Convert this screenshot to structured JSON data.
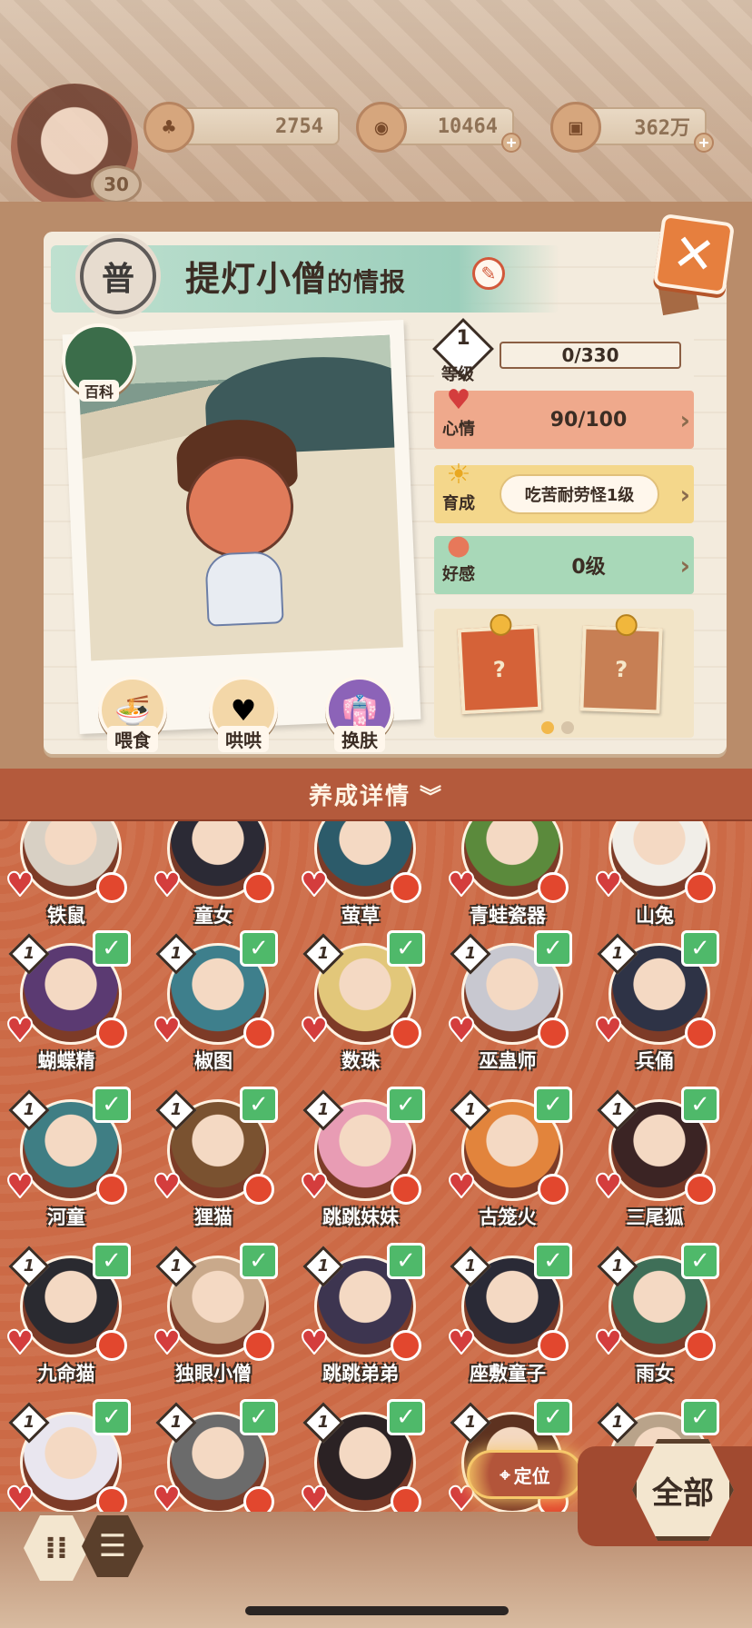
{
  "hud": {
    "player_level": "30",
    "resources": [
      {
        "name": "jade",
        "icon": "pine-coin-icon",
        "value": "2754"
      },
      {
        "name": "stamina",
        "icon": "spiral-coin-icon",
        "value": "10464"
      },
      {
        "name": "gold",
        "icon": "copper-coin-icon",
        "value": "362万"
      }
    ]
  },
  "info": {
    "rank": "普",
    "name": "提灯小僧",
    "name_suffix": "的情报",
    "wiki_label": "百科",
    "actions": [
      {
        "label": "喂食",
        "icon": "bowl-icon"
      },
      {
        "label": "哄哄",
        "icon": "milk-icon"
      },
      {
        "label": "换肤",
        "icon": "clothes-icon"
      }
    ],
    "level": {
      "value": "1",
      "label": "等级",
      "progress": "0/330"
    },
    "mood": {
      "label": "心情",
      "value": "90/100"
    },
    "growth": {
      "label": "育成",
      "value": "吃苦耐劳怪1级"
    },
    "affection": {
      "label": "好感",
      "value": "0级"
    },
    "reward_cards": [
      "?",
      "?"
    ],
    "page_dots": 2,
    "active_dot": 0
  },
  "detail_bar": {
    "label": "养成详情",
    "chevron": "»"
  },
  "grid": {
    "level_text": "1",
    "rows": [
      [
        {
          "name": "铁鼠",
          "hair": "#d8d0c4",
          "level": false
        },
        {
          "name": "童女",
          "hair": "#2b2a35",
          "level": false
        },
        {
          "name": "萤草",
          "hair": "#2c5b6a",
          "level": false
        },
        {
          "name": "青蛙瓷器",
          "hair": "#5b8a3c",
          "level": false
        },
        {
          "name": "山兔",
          "hair": "#f1eee8",
          "level": false
        }
      ],
      [
        {
          "name": "蝴蝶精",
          "hair": "#5b3a72",
          "level": true
        },
        {
          "name": "椒图",
          "hair": "#3e7f8c",
          "level": true
        },
        {
          "name": "数珠",
          "hair": "#e2c77a",
          "level": true
        },
        {
          "name": "巫蛊师",
          "hair": "#c8c8d0",
          "level": true
        },
        {
          "name": "兵俑",
          "hair": "#2e3346",
          "level": true
        }
      ],
      [
        {
          "name": "河童",
          "hair": "#3f7e84",
          "level": true
        },
        {
          "name": "狸猫",
          "hair": "#7a5230",
          "level": true
        },
        {
          "name": "跳跳妹妹",
          "hair": "#e89cb4",
          "level": true
        },
        {
          "name": "古笼火",
          "hair": "#e2843c",
          "level": true
        },
        {
          "name": "三尾狐",
          "hair": "#3b2424",
          "level": true
        }
      ],
      [
        {
          "name": "九命猫",
          "hair": "#2a2a30",
          "level": true
        },
        {
          "name": "独眼小僧",
          "hair": "#c9a98b",
          "level": true
        },
        {
          "name": "跳跳弟弟",
          "hair": "#3d3550",
          "level": true
        },
        {
          "name": "座敷童子",
          "hair": "#2a2a36",
          "level": true
        },
        {
          "name": "雨女",
          "hair": "#3f6f58",
          "level": true
        }
      ],
      [
        {
          "name": "",
          "hair": "#e9e6ef",
          "level": true
        },
        {
          "name": "",
          "hair": "#6b6b6b",
          "level": true
        },
        {
          "name": "",
          "hair": "#2b2224",
          "level": true
        },
        {
          "name": "",
          "hair": "#5d3220",
          "level": true
        },
        {
          "name": "",
          "hair": "#b9a38a",
          "level": true
        }
      ]
    ]
  },
  "controls": {
    "locate_label": "定位",
    "all_label": "全部"
  }
}
